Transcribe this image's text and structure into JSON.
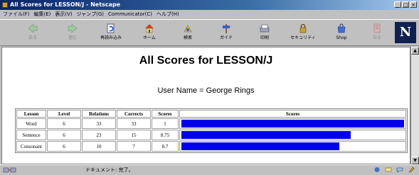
{
  "window": {
    "title": "All Scores for LESSON/J - Netscape",
    "minimize": "_",
    "maximize": "□",
    "close": "×"
  },
  "menu": [
    "ファイル(F)",
    "編集(E)",
    "表示(V)",
    "ジャンプ(G)",
    "Communicator(C)",
    "ヘルプ(H)"
  ],
  "toolbar": {
    "back": "戻る",
    "forward": "進む",
    "reload": "再読み込み",
    "home": "ホーム",
    "search": "検索",
    "guide": "ガイド",
    "print": "印刷",
    "security": "セキュリティ",
    "shop": "Shop",
    "stop": "中止",
    "logo": "N"
  },
  "page": {
    "title": "All Scores for LESSON/J",
    "user_line": "User Name = George Rings"
  },
  "table": {
    "headers": [
      "Lesson",
      "Level",
      "Relations",
      "Corrects",
      "Scores",
      "Scores"
    ],
    "rows": [
      {
        "lesson": "Word",
        "level": "6",
        "relations": "33",
        "corrects": "33",
        "score": "1",
        "bar_fraction": 1.0
      },
      {
        "lesson": "Sentence",
        "level": "6",
        "relations": "23",
        "corrects": "15",
        "score": "8.75",
        "bar_fraction": 0.76
      },
      {
        "lesson": "Consonant",
        "level": "6",
        "relations": "10",
        "corrects": "7",
        "score": "8.7",
        "bar_fraction": 0.71
      }
    ]
  },
  "status": {
    "text": "ドキュメント: 完了。"
  },
  "colors": {
    "bar": "#0000ee",
    "titlebar": "#0a246a"
  }
}
